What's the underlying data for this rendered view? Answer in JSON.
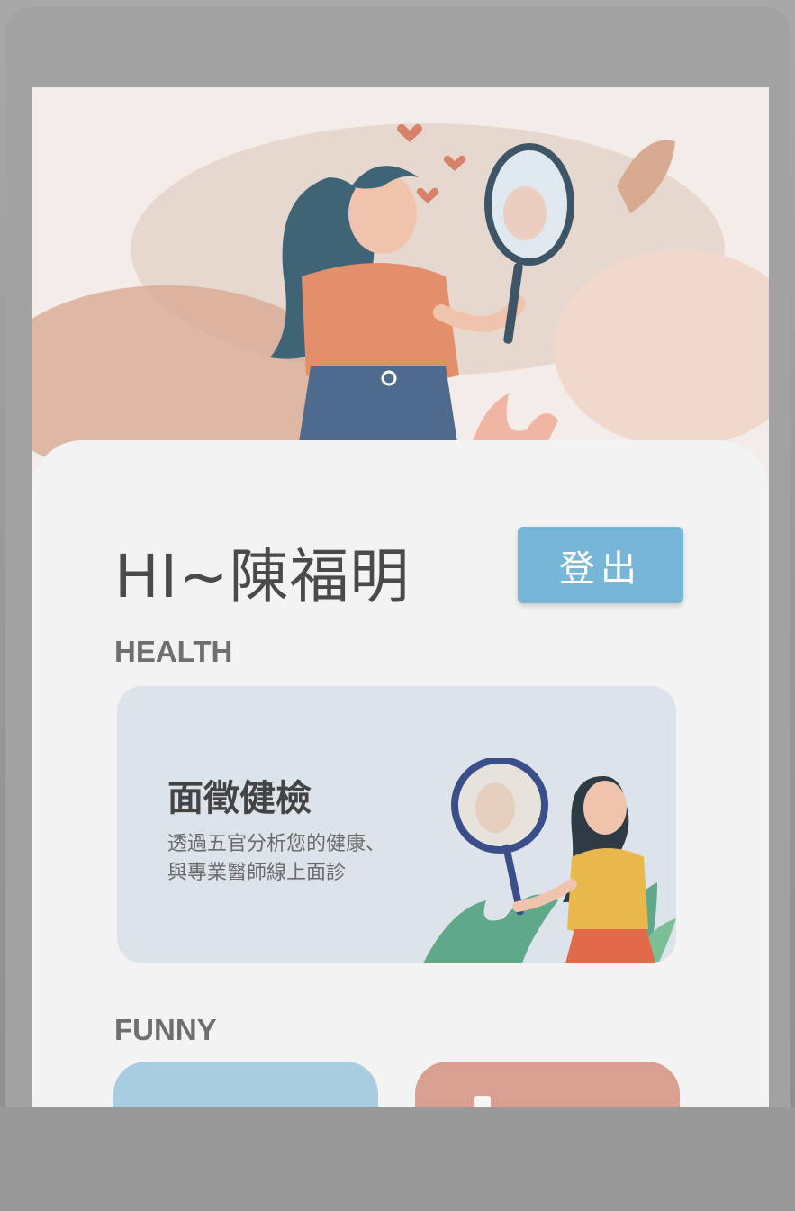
{
  "colors": {
    "accent": "#78b6d8",
    "heading": "#4a4a4a",
    "section": "#6f6f6f",
    "card_bg": "#dde3ea",
    "funny_blue": "#a8cde0",
    "funny_red": "#d9a092"
  },
  "header": {
    "greeting": "HI~陳福明",
    "logout_label": "登出"
  },
  "sections": {
    "health": {
      "title": "HEALTH",
      "card": {
        "title": "面徵健檢",
        "description_line1": "透過五官分析您的健康、",
        "description_line2": "與專業醫師線上面診",
        "illustration_icon": "woman-with-magnifier-icon"
      }
    },
    "funny": {
      "title": "FUNNY"
    }
  },
  "hero": {
    "illustration_icon": "woman-with-mirror-icon"
  }
}
